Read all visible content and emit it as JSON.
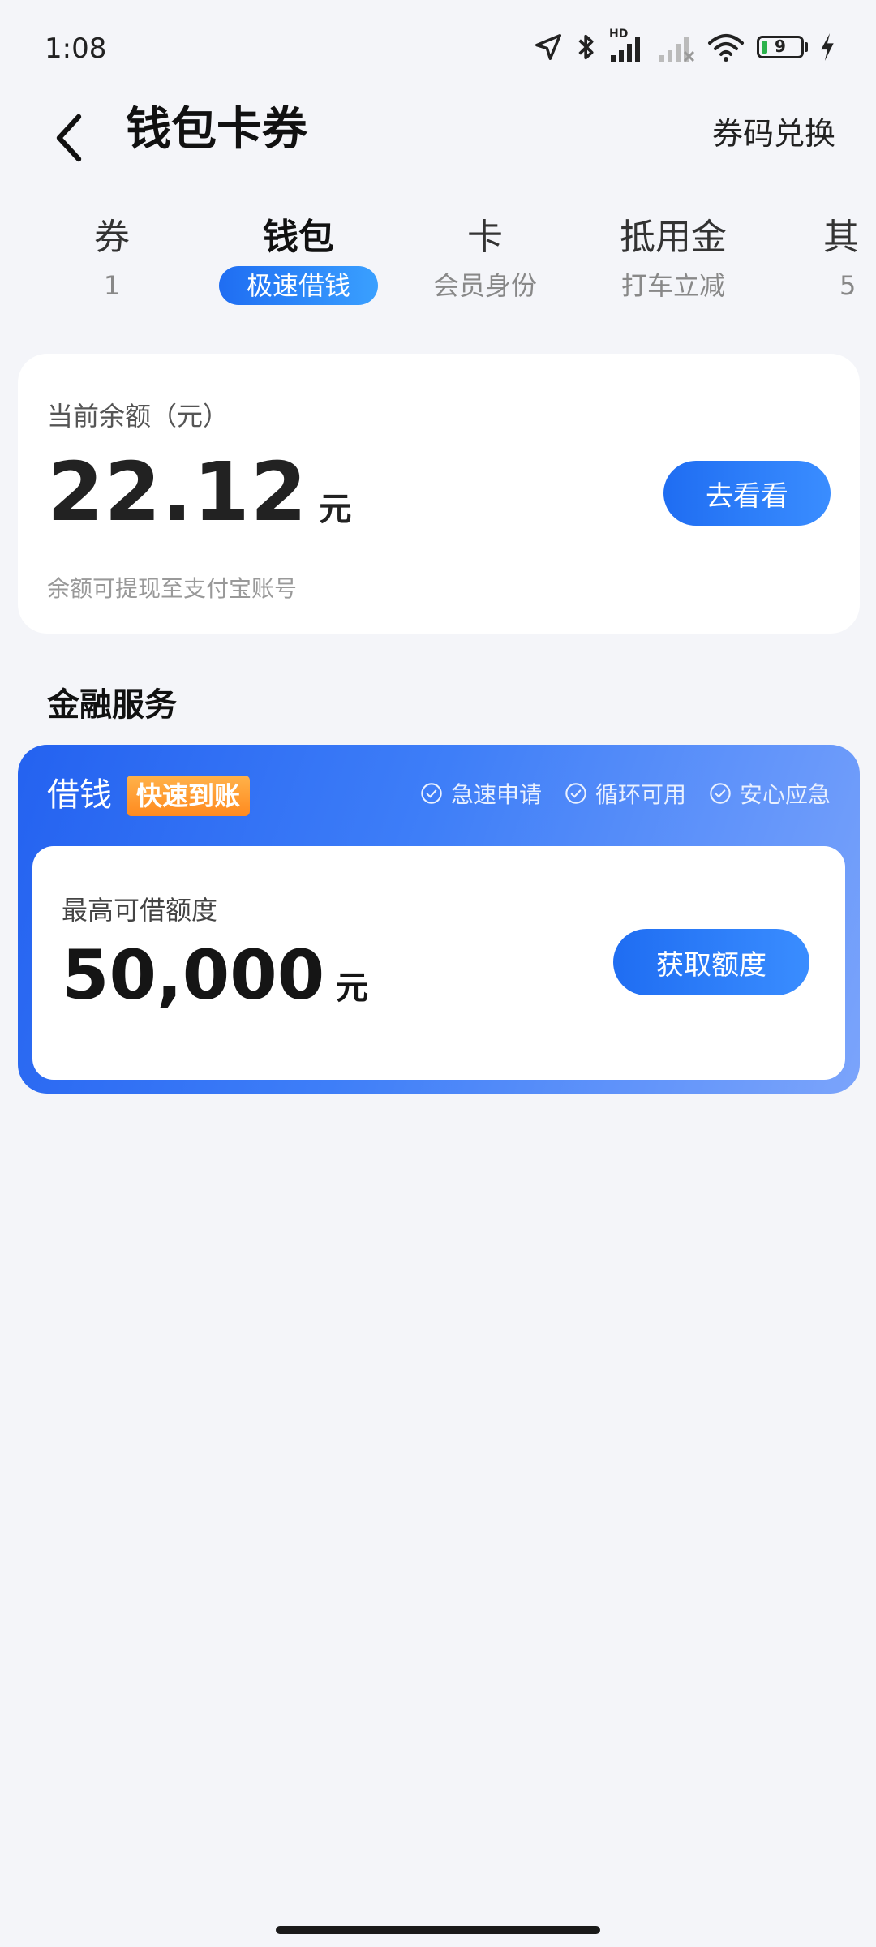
{
  "status_bar": {
    "time": "1:08",
    "battery": "9",
    "hd_label": "HD"
  },
  "header": {
    "title": "钱包卡券",
    "redeem_label": "券码兑换"
  },
  "tabs": [
    {
      "label": "券",
      "sub": "1"
    },
    {
      "label": "钱包",
      "sub": "极速借钱",
      "active": true
    },
    {
      "label": "卡",
      "sub": "会员身份"
    },
    {
      "label": "抵用金",
      "sub": "打车立减"
    },
    {
      "label": "其",
      "sub": "5"
    }
  ],
  "balance": {
    "label": "当前余额（元）",
    "amount": "22.12",
    "unit": "元",
    "button_label": "去看看",
    "note": "余额可提现至支付宝账号"
  },
  "finance": {
    "section_title": "金融服务",
    "loan_title": "借钱",
    "badge": "快速到账",
    "features": [
      "急速申请",
      "循环可用",
      "安心应急"
    ],
    "limit_label": "最高可借额度",
    "limit_amount": "50,000",
    "unit": "元",
    "button_label": "获取额度"
  },
  "colors": {
    "accent": "#1f6df2",
    "badge": "#ff8a1f",
    "background": "#f4f5f9"
  }
}
